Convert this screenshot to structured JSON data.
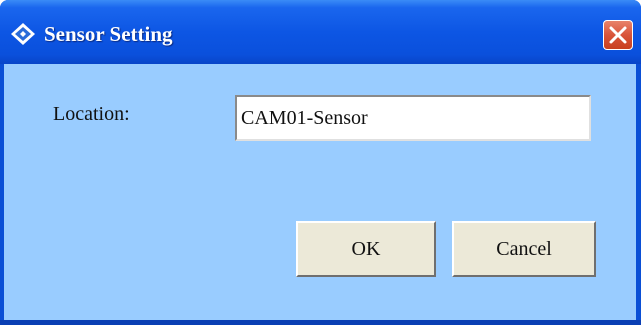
{
  "window": {
    "title": "Sensor Setting",
    "title_icon": "diamond-app-icon",
    "close_icon": "close-icon",
    "accent_color": "#0a50dc",
    "client_color": "#99ccff",
    "close_color": "#d9543a"
  },
  "form": {
    "location_label": "Location:",
    "location_value": "CAM01-Sensor"
  },
  "buttons": {
    "ok_label": "OK",
    "cancel_label": "Cancel"
  }
}
